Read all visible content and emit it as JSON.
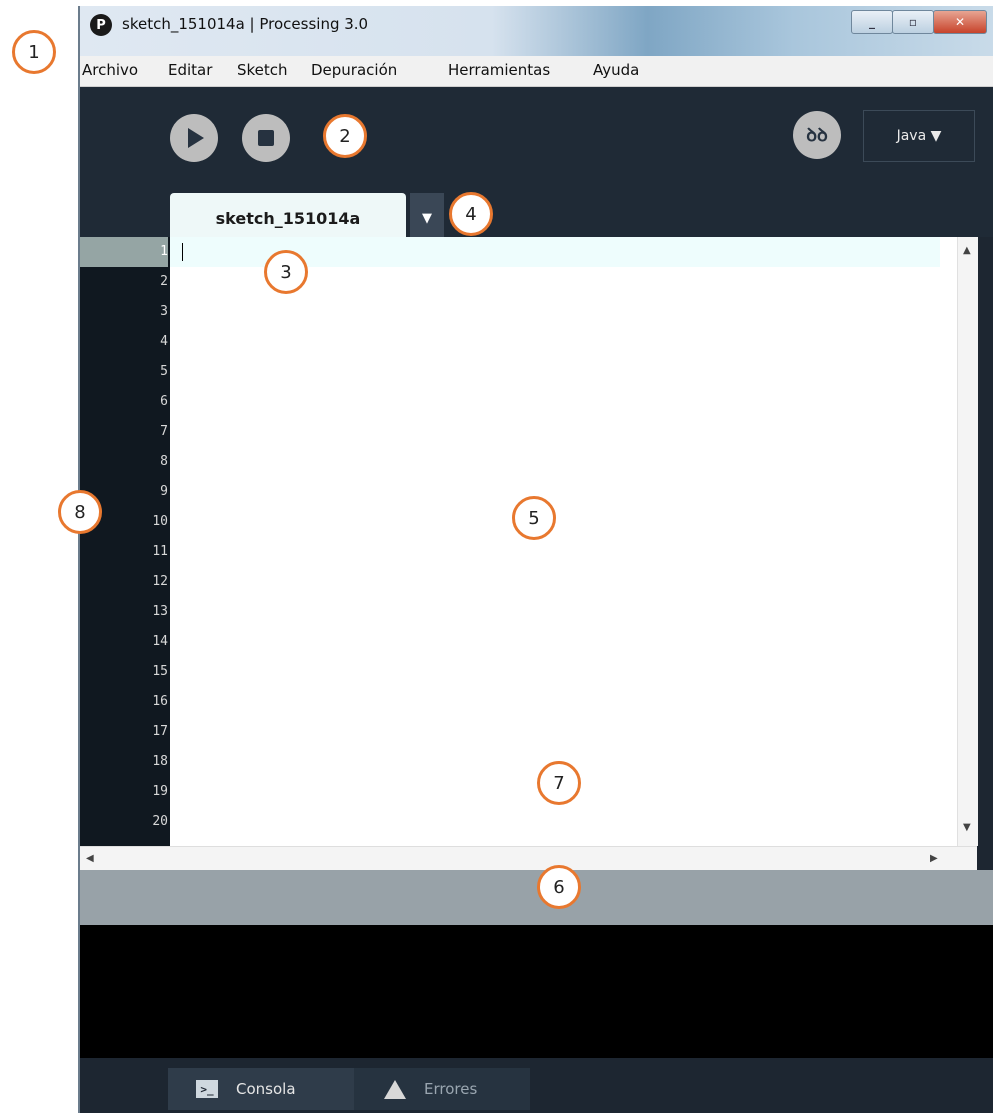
{
  "window": {
    "title": "sketch_151014a | Processing 3.0",
    "app_icon": "P",
    "controls": [
      "minimize",
      "maximize",
      "close"
    ]
  },
  "menu": [
    "Archivo",
    "Editar",
    "Sketch",
    "Depuración",
    "Herramientas",
    "Ayuda"
  ],
  "toolbar": {
    "run_icon": "play-icon",
    "stop_icon": "stop-icon",
    "debug_icon": "debugger-icon",
    "mode_label": "Java ▼"
  },
  "tabs": {
    "active": "sketch_151014a",
    "dropdown": "▼"
  },
  "editor": {
    "line_numbers": [
      "1",
      "2",
      "3",
      "4",
      "5",
      "6",
      "7",
      "8",
      "9",
      "10",
      "11",
      "12",
      "13",
      "14",
      "15",
      "16",
      "17",
      "18",
      "19",
      "20"
    ],
    "current_line": 1,
    "content": ""
  },
  "footer": {
    "tabs": [
      {
        "label": "Consola",
        "icon": "console-icon",
        "active": true
      },
      {
        "label": "Errores",
        "icon": "warning-icon",
        "active": false
      }
    ]
  },
  "callouts": [
    "1",
    "2",
    "3",
    "4",
    "5",
    "6",
    "7",
    "8"
  ],
  "colors": {
    "ide_background": "#1d2631",
    "callout_border": "#e8782f",
    "console": "#000000",
    "status_bar": "#98a2a8"
  }
}
